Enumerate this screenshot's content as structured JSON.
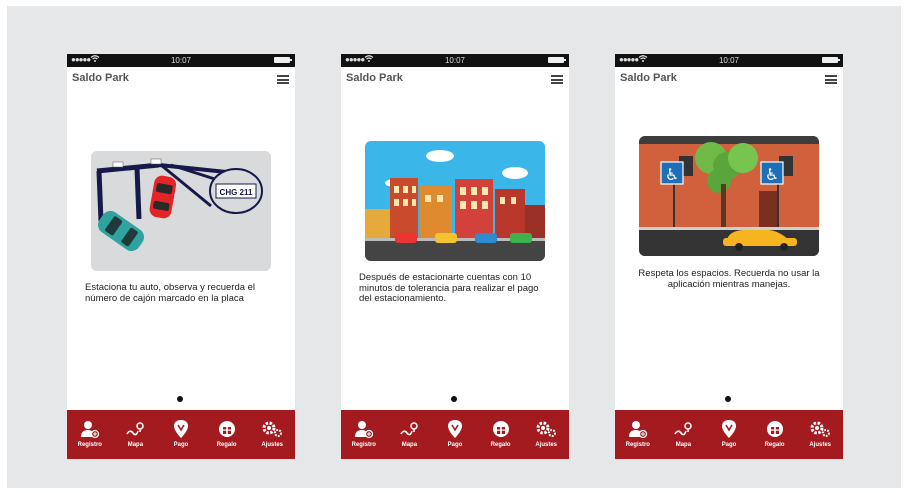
{
  "screens": [
    {
      "app_title": "Saldo Park",
      "status": {
        "time": "10:07"
      },
      "caption": "Estaciona tu auto, observa y recuerda el número de cajón marcado en la placa",
      "plate_text": "CHG 211"
    },
    {
      "app_title": "Saldo Park",
      "status": {
        "time": "10:07"
      },
      "caption": "Después de estacionarte cuentas con 10 minutos de tolerancia para realizar el pago del estacionamiento."
    },
    {
      "app_title": "Saldo Park",
      "status": {
        "time": "10:07"
      },
      "caption": "Respeta los espacios. Recuerda no usar la aplicación mientras manejas."
    }
  ],
  "tabbar": {
    "items": [
      {
        "label": "Registro",
        "icon": "user-add-icon"
      },
      {
        "label": "Mapa",
        "icon": "map-icon"
      },
      {
        "label": "Pago",
        "icon": "location-pin-icon"
      },
      {
        "label": "Regalo",
        "icon": "gift-icon"
      },
      {
        "label": "Ajustes",
        "icon": "gears-icon"
      }
    ]
  },
  "colors": {
    "brand_red": "#a31b1f",
    "background": "#e6e7e8",
    "status_bar": "#111111"
  }
}
